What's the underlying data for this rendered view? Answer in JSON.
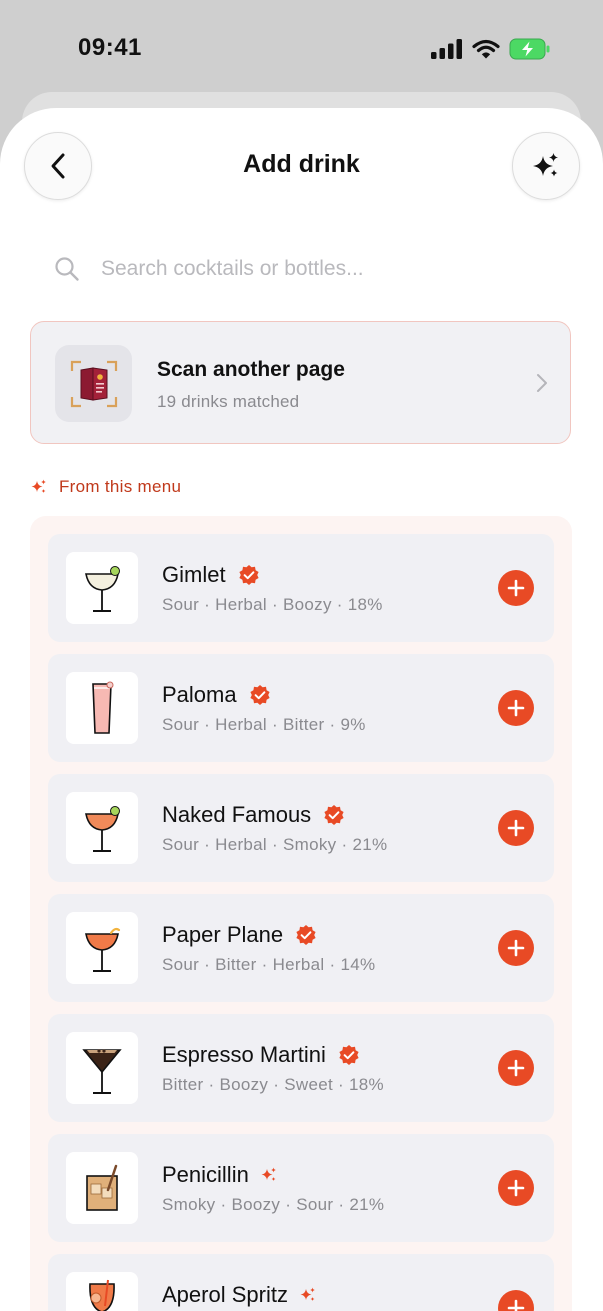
{
  "status_bar": {
    "time": "09:41"
  },
  "header": {
    "title": "Add drink"
  },
  "search": {
    "placeholder": "Search cocktails or bottles..."
  },
  "scan_card": {
    "title": "Scan another page",
    "subtitle": "19 drinks matched"
  },
  "section": {
    "label": "From this menu"
  },
  "colors": {
    "accent": "#e84a25",
    "accent_text": "#c0391b",
    "panel_bg": "#fdf4f2",
    "row_bg": "#f0f0f4"
  },
  "drinks": [
    {
      "name": "Gimlet",
      "tags": "Sour · Herbal · Boozy · 18%",
      "badge": "verified",
      "glass": "coupe-clear-lime"
    },
    {
      "name": "Paloma",
      "tags": "Sour · Herbal · Bitter · 9%",
      "badge": "verified",
      "glass": "highball-pink"
    },
    {
      "name": "Naked Famous",
      "tags": "Sour · Herbal · Smoky · 21%",
      "badge": "verified",
      "glass": "coupe-orange-lime"
    },
    {
      "name": "Paper Plane",
      "tags": "Sour · Bitter · Herbal · 14%",
      "badge": "verified",
      "glass": "coupe-orange"
    },
    {
      "name": "Espresso Martini",
      "tags": "Bitter · Boozy · Sweet · 18%",
      "badge": "verified",
      "glass": "martini-coffee"
    },
    {
      "name": "Penicillin",
      "tags": "Smoky · Boozy · Sour · 21%",
      "badge": "sparkle",
      "glass": "rocks-amber"
    },
    {
      "name": "Aperol Spritz",
      "tags": "",
      "badge": "sparkle",
      "glass": "wine-orange"
    }
  ]
}
